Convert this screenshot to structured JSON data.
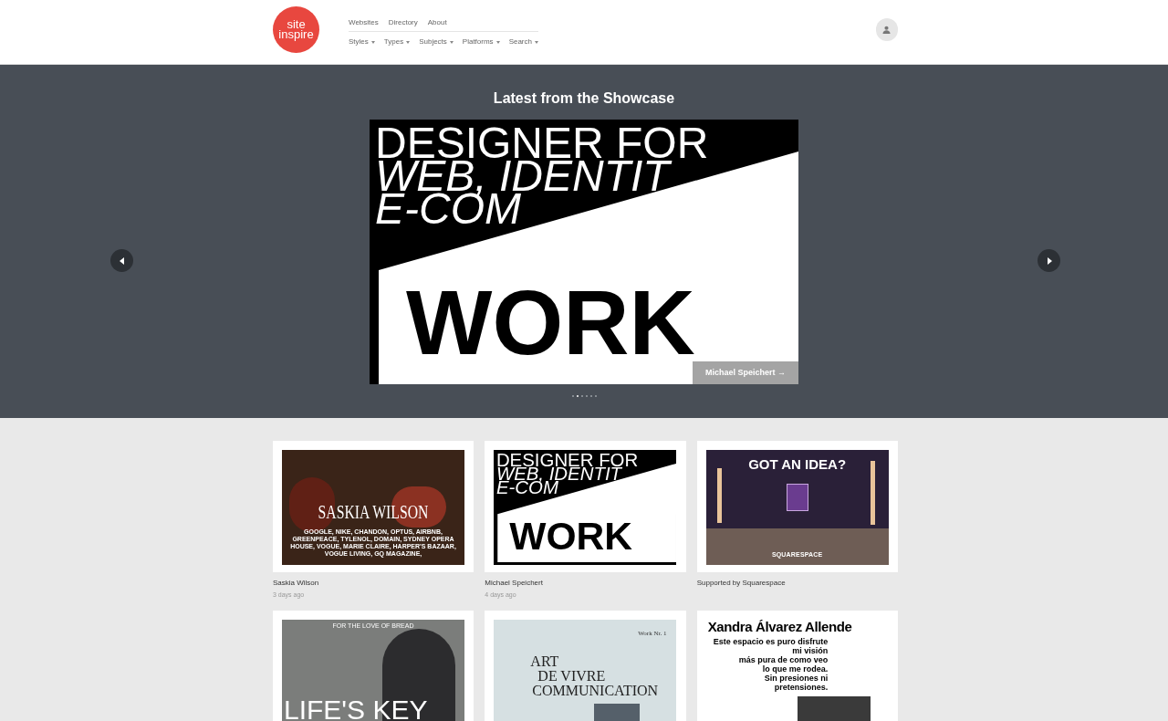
{
  "header": {
    "logo": [
      "site",
      "inspire"
    ],
    "nav_primary": [
      "Websites",
      "Directory",
      "About"
    ],
    "nav_secondary": [
      {
        "label": "Styles"
      },
      {
        "label": "Types"
      },
      {
        "label": "Subjects"
      },
      {
        "label": "Platforms"
      },
      {
        "label": "Search"
      }
    ]
  },
  "showcase": {
    "title": "Latest from the Showcase",
    "featured": {
      "lines": [
        "DESIGNER FOR",
        "WEB, IDENTIT",
        "E-COM"
      ],
      "band_text": "WORK",
      "caption": "Michael Speichert →"
    },
    "dots": [
      {
        "selected": false
      },
      {
        "selected": true
      },
      {
        "selected": false
      },
      {
        "selected": false
      },
      {
        "selected": false
      },
      {
        "selected": false
      }
    ]
  },
  "cards": [
    {
      "kind": "portfolio",
      "title": "Saskia Wilson",
      "time": "3 days ago",
      "headline": "SASKIA WILSON",
      "body": "GOOGLE, NIKE, CHANDON, OPTUS, AIRBNB, GREENPEACE, TYLENOL, DOMAIN, SYDNEY OPERA HOUSE, VOGUE, MARIE CLAIRE, HARPER'S BAZAAR, VOGUE LIVING, GQ MAGAZINE,"
    },
    {
      "kind": "designer",
      "title": "Michael Speichert",
      "time": "4 days ago",
      "lines": [
        "DESIGNER FOR",
        "WEB, IDENTIT",
        "E-COM"
      ],
      "band_text": "WORK"
    },
    {
      "kind": "ad",
      "title": "Supported by Squarespace",
      "headline": "GOT AN IDEA?",
      "brand": "SQUARESPACE"
    },
    {
      "kind": "bread",
      "top": "FOR THE LOVE OF BREAD",
      "headline": "LIFE'S KEY"
    },
    {
      "kind": "art",
      "tag": "Work Nr. 1",
      "lines": [
        "ART",
        "DE VIVRE",
        "COMMUNICATION"
      ]
    },
    {
      "kind": "xandra",
      "headline": "Xandra Álvarez Allende",
      "lines": [
        "Este espacio es puro disfrute",
        "mi visión",
        "más pura de como veo",
        "lo que me rodea.",
        "Sin presiones ni",
        "pretensiones."
      ]
    }
  ]
}
